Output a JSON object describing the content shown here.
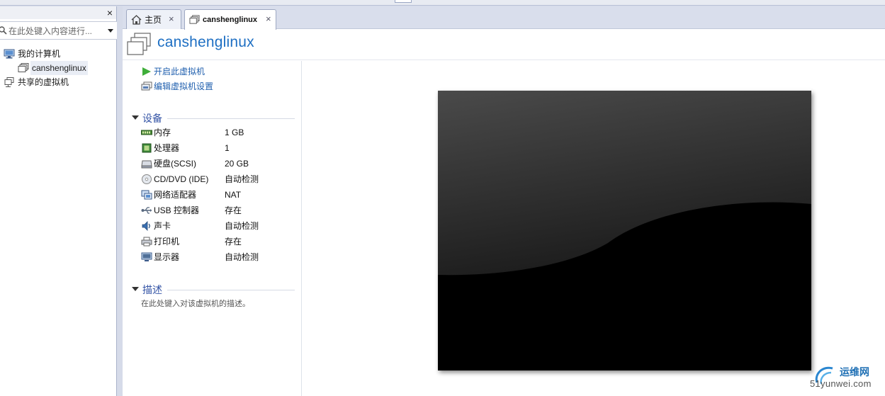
{
  "library": {
    "close_label": "×",
    "search_placeholder": "在此处键入内容进行...",
    "tree": [
      {
        "label": "我的计算机",
        "icon": "computer-icon"
      },
      {
        "label": "canshenglinux",
        "icon": "vm-icon"
      },
      {
        "label": "共享的虚拟机",
        "icon": "shared-vm-icon"
      }
    ]
  },
  "tabs": [
    {
      "label": "主页",
      "icon": "home-icon",
      "close": "×"
    },
    {
      "label": "canshenglinux",
      "icon": "vm-icon",
      "close": "×"
    }
  ],
  "vm": {
    "title": "canshenglinux",
    "actions": [
      {
        "label": "开启此虚拟机",
        "icon": "play-icon"
      },
      {
        "label": "编辑虚拟机设置",
        "icon": "edit-settings-icon"
      }
    ],
    "devices_title": "设备",
    "devices": [
      {
        "name": "内存",
        "value": "1 GB",
        "icon": "memory-icon"
      },
      {
        "name": "处理器",
        "value": "1",
        "icon": "cpu-icon"
      },
      {
        "name": "硬盘(SCSI)",
        "value": "20 GB",
        "icon": "harddisk-icon"
      },
      {
        "name": "CD/DVD (IDE)",
        "value": "自动检测",
        "icon": "cd-dvd-icon"
      },
      {
        "name": "网络适配器",
        "value": "NAT",
        "icon": "network-adapter-icon"
      },
      {
        "name": "USB 控制器",
        "value": "存在",
        "icon": "usb-icon"
      },
      {
        "name": "声卡",
        "value": "自动检测",
        "icon": "sound-card-icon"
      },
      {
        "name": "打印机",
        "value": "存在",
        "icon": "printer-icon"
      },
      {
        "name": "显示器",
        "value": "自动检测",
        "icon": "display-icon"
      }
    ],
    "description_title": "描述",
    "description_hint": "在此处键入对该虚拟机的描述。"
  },
  "watermark": {
    "cn": "运维网",
    "en": "51yunwei.com"
  },
  "colors": {
    "accent": "#1e6fc3",
    "section": "#3454a6",
    "link": "#1f5fae",
    "play": "#3fae3a"
  }
}
